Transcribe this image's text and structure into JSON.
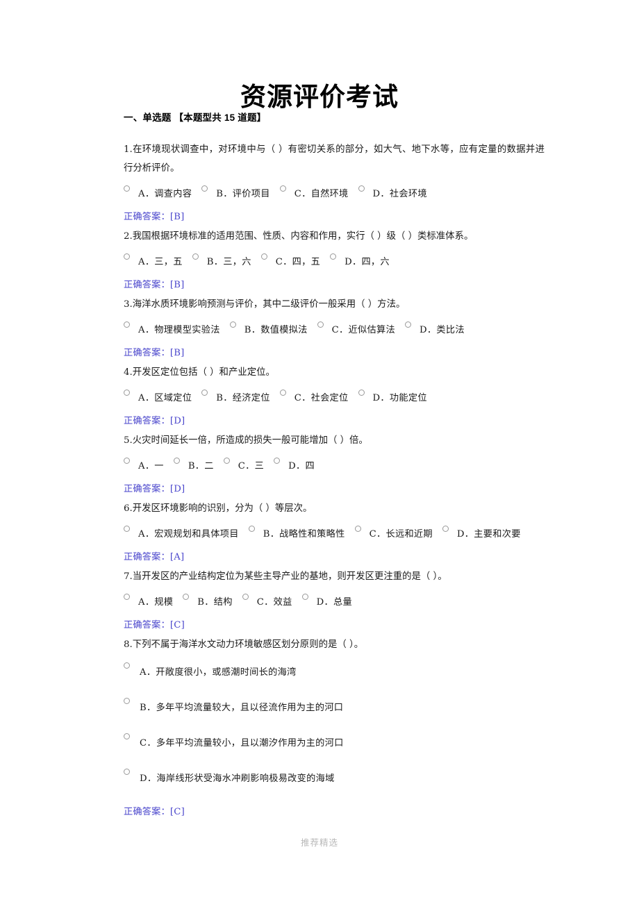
{
  "document": {
    "title": "资源评价考试",
    "footer_watermark": "推荐精选",
    "answer_color": "#4a46cc"
  },
  "section": {
    "header": "一、单选题 【本题型共 15 道题】"
  },
  "questions": [
    {
      "stem": "1.在环境现状调查中，对环境中与（      ）有密切关系的部分，如大气、地下水等，应有定量的数据并进行分析评价。",
      "layout": "inline",
      "options": [
        "A．调查内容",
        "B．评价项目",
        "C．自然环境",
        "D．社会环境"
      ],
      "answer": "正确答案：[B]"
    },
    {
      "stem": "2.我国根据环境标准的适用范围、性质、内容和作用，实行（      ）级（      ）类标准体系。",
      "layout": "inline",
      "options": [
        "A．三，五",
        "B．三，六",
        "C．四，五",
        "D．四，六"
      ],
      "answer": "正确答案：[B]"
    },
    {
      "stem": "3.海洋水质环境影响预测与评价，其中二级评价一般采用（      ）方法。",
      "layout": "inline",
      "options": [
        "A．物理模型实验法",
        "B．数值模拟法",
        "C．近似估算法",
        "D．类比法"
      ],
      "answer": "正确答案：[B]"
    },
    {
      "stem": "4.开发区定位包括（      ）和产业定位。",
      "layout": "inline",
      "options": [
        "A．区域定位",
        "B．经济定位",
        "C．社会定位",
        "D．功能定位"
      ],
      "answer": "正确答案：[D]"
    },
    {
      "stem": "5.火灾时间延长一倍，所造成的损失一般可能增加（      ）倍。",
      "layout": "inline",
      "options": [
        "A．一",
        "B．二",
        "C．三",
        "D．四"
      ],
      "answer": "正确答案：[D]"
    },
    {
      "stem": "6.开发区环境影响的识别，分为（      ）等层次。",
      "layout": "inline",
      "options": [
        "A．宏观规划和具体项目",
        "B．战略性和策略性",
        "C．长远和近期",
        "D．主要和次要"
      ],
      "answer": "正确答案：[A]"
    },
    {
      "stem": "7.当开发区的产业结构定位为某些主导产业的基地，则开发区更注重的是（      ）。",
      "layout": "inline",
      "options": [
        "A．规模",
        "B．结构",
        "C．效益",
        "D．总量"
      ],
      "answer": "正确答案：[C]"
    },
    {
      "stem": "8.下列不属于海洋水文动力环境敏感区划分原则的是（      ）。",
      "layout": "stacked",
      "options": [
        "A．开敞度很小，或感潮时间长的海湾",
        "B．多年平均流量较大，且以径流作用为主的河口",
        "C．多年平均流量较小，且以潮汐作用为主的河口",
        "D．海岸线形状受海水冲刷影响极易改变的海域"
      ],
      "answer": "正确答案：[C]"
    }
  ]
}
